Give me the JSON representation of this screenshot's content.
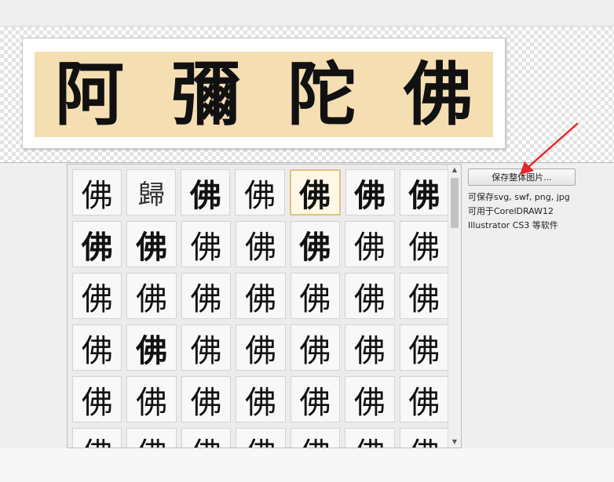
{
  "preview": {
    "characters": [
      "阿",
      "彌",
      "陀",
      "佛"
    ]
  },
  "glyph_grid": {
    "rows": [
      [
        "佛",
        "歸",
        "佛",
        "佛",
        "佛",
        "佛",
        "佛"
      ],
      [
        "佛",
        "佛",
        "佛",
        "佛",
        "佛",
        "佛",
        "佛"
      ],
      [
        "佛",
        "佛",
        "佛",
        "佛",
        "佛",
        "佛",
        "佛"
      ],
      [
        "佛",
        "佛",
        "佛",
        "佛",
        "佛",
        "佛",
        "佛"
      ],
      [
        "佛",
        "佛",
        "佛",
        "佛",
        "佛",
        "佛",
        "佛"
      ],
      [
        "佛",
        "佛",
        "佛",
        "佛",
        "佛",
        "佛",
        "佛"
      ]
    ],
    "selected": "佛"
  },
  "side_panel": {
    "save_label": "保存整体图片...",
    "info_lines": [
      "可保存svg, swf, png, jpg",
      "可用于CorelDRAW12",
      "Illustrator CS3 等软件"
    ]
  },
  "colors": {
    "preview_band": "#f6deb3",
    "arrow": "#e8262b",
    "selected_cell": "#e0c27b"
  },
  "icons": {
    "scroll_up": "▲",
    "scroll_down": "▼"
  }
}
